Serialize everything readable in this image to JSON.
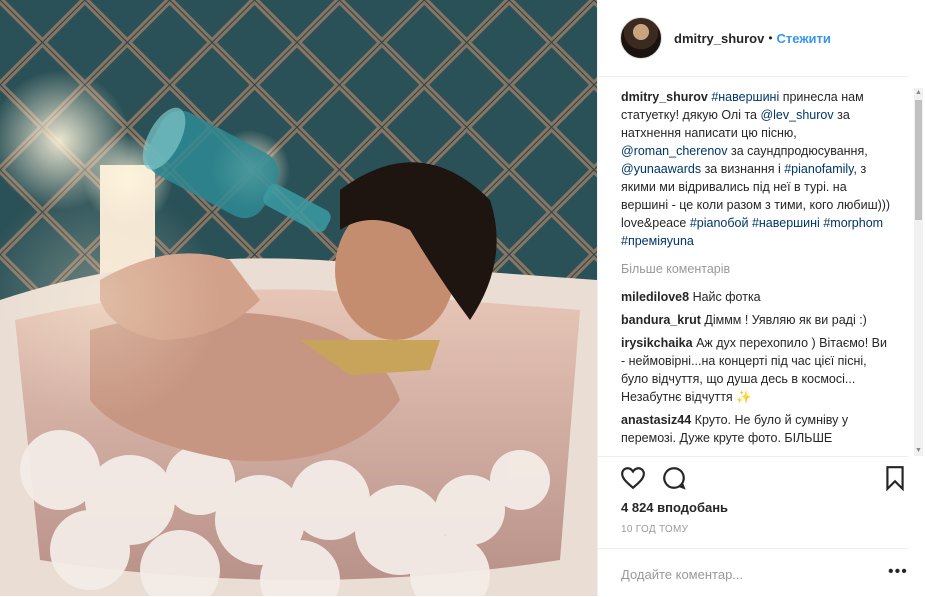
{
  "post": {
    "username": "dmitry_shurov",
    "separator": "•",
    "follow_label": "Стежити",
    "caption": {
      "username": "dmitry_shurov",
      "parts": [
        {
          "t": "tag",
          "v": "#навершині"
        },
        {
          "t": "text",
          "v": " принесла нам статуетку! дякую Олі та "
        },
        {
          "t": "tag",
          "v": "@lev_shurov"
        },
        {
          "t": "text",
          "v": " за натхнення написати цю пісню, "
        },
        {
          "t": "tag",
          "v": "@roman_cherenov"
        },
        {
          "t": "text",
          "v": " за саундпродюсування, "
        },
        {
          "t": "tag",
          "v": "@yunaawards"
        },
        {
          "t": "text",
          "v": " за визнання і "
        },
        {
          "t": "tag",
          "v": "#pianofamily"
        },
        {
          "t": "text",
          "v": ", з якими ми відривались під неї в турі. на вершині - це коли разом з тими, кого любиш))) love&peace "
        },
        {
          "t": "tag",
          "v": "#pianoбой"
        },
        {
          "t": "text",
          "v": " "
        },
        {
          "t": "tag",
          "v": "#навершині"
        },
        {
          "t": "text",
          "v": " "
        },
        {
          "t": "tag",
          "v": "#morphom"
        },
        {
          "t": "text",
          "v": " "
        },
        {
          "t": "tag",
          "v": "#преміяyuna"
        }
      ]
    },
    "more_comments_label": "Більше коментарів",
    "comments": [
      {
        "user": "miledilove8",
        "text": "Найс фотка"
      },
      {
        "user": "bandura_krut",
        "text": "Діммм ! Уявляю як ви раді :)"
      },
      {
        "user": "irysikchaika",
        "text": "Аж дух перехопило ) Вітаємо! Ви - неймовірні...на концерті під час цієї пісні, було відчуття, що душа десь в космосі... Незабутнє відчуття ✨"
      },
      {
        "user": "anastasiz44",
        "text": "Круто. Не було й сумніву у перемозі. Дуже круте фото. БІЛЬШЕ"
      }
    ],
    "likes": "4 824 вподобань",
    "time": "10 ГОД ТОМУ",
    "add_comment_placeholder": "Додайте коментар...",
    "more_options": "•••"
  },
  "icons": {
    "like": "heart-icon",
    "comment": "comment-icon",
    "save": "bookmark-icon"
  },
  "colors": {
    "link": "#003569",
    "follow": "#3897f0",
    "muted": "#999999"
  }
}
